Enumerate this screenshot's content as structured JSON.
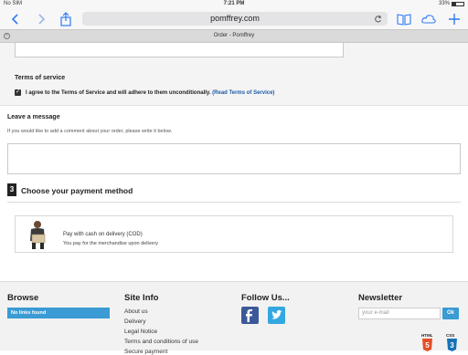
{
  "statusbar": {
    "carrier": "No SIM",
    "time": "7:21 PM",
    "battery": "33%",
    "battery_level": 0.33
  },
  "toolbar": {
    "url": "pomffrey.com"
  },
  "tab": {
    "title": "Order - Pomffrey"
  },
  "terms": {
    "heading": "Terms of service",
    "agree_text": "I agree to the Terms of Service and will adhere to them unconditionally.",
    "link_text": "(Read Terms of Service)",
    "checked": true
  },
  "comment": {
    "heading": "Leave a message",
    "hint": "If you would like to add a comment about your order, please write it below."
  },
  "payment": {
    "step": "3",
    "heading": "Choose your payment method",
    "option_title": "Pay with cash on delivery (COD)",
    "option_sub": "You pay for the merchandise upon delivery"
  },
  "footer": {
    "browse": {
      "heading": "Browse",
      "nolinks": "No links found"
    },
    "siteinfo": {
      "heading": "Site Info",
      "links": [
        "About us",
        "Delivery",
        "Legal Notice",
        "Terms and conditions of use",
        "Secure payment"
      ]
    },
    "follow": {
      "heading": "Follow Us..."
    },
    "newsletter": {
      "heading": "Newsletter",
      "placeholder": "your e-mail",
      "button": "Ok"
    },
    "badges": [
      "HTML",
      "CSS"
    ]
  },
  "colors": {
    "accent": "#3a9bd5",
    "link": "#1a5aa6",
    "ios_blue": "#2f7cf6"
  }
}
